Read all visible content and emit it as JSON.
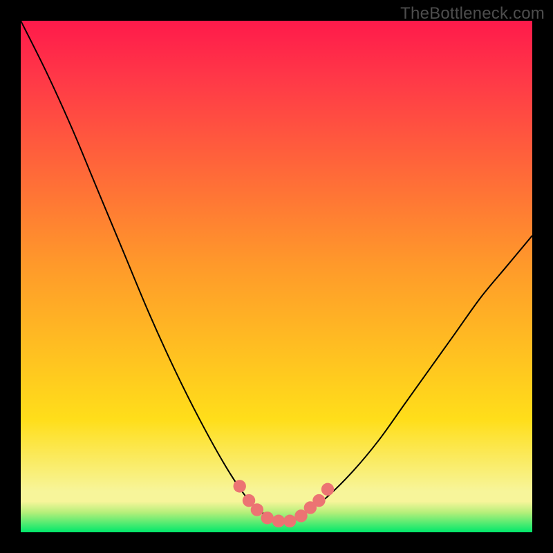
{
  "watermark": "TheBottleneck.com",
  "chart_data": {
    "type": "line",
    "title": "",
    "xlabel": "",
    "ylabel": "",
    "xlim": [
      0,
      100
    ],
    "ylim": [
      0,
      100
    ],
    "background_gradient": {
      "top": "#ff1a4b",
      "mid": "#ffde1a",
      "bottom": "#00e86b"
    },
    "series": [
      {
        "name": "bottleneck-curve",
        "color": "#000000",
        "stroke_width": 2,
        "x": [
          0,
          5,
          10,
          15,
          20,
          25,
          30,
          35,
          40,
          44,
          47,
          50,
          53,
          56,
          60,
          65,
          70,
          75,
          80,
          85,
          90,
          95,
          100
        ],
        "values": [
          100,
          90,
          79,
          67,
          55,
          43,
          32,
          22,
          13,
          7,
          4,
          2.2,
          2.2,
          4,
          7,
          12,
          18,
          25,
          32,
          39,
          46,
          52,
          58
        ]
      }
    ],
    "markers": {
      "name": "bottleneck-region-dots",
      "color": "#ec7373",
      "radius": 9.2,
      "x": [
        42.8,
        44.6,
        46.2,
        48.2,
        50.4,
        52.6,
        54.8,
        56.6,
        58.3,
        60.0
      ],
      "values": [
        9.0,
        6.2,
        4.4,
        2.8,
        2.2,
        2.2,
        3.2,
        4.8,
        6.2,
        8.4
      ]
    },
    "green_band": {
      "y0": 0,
      "y1": 6
    }
  }
}
